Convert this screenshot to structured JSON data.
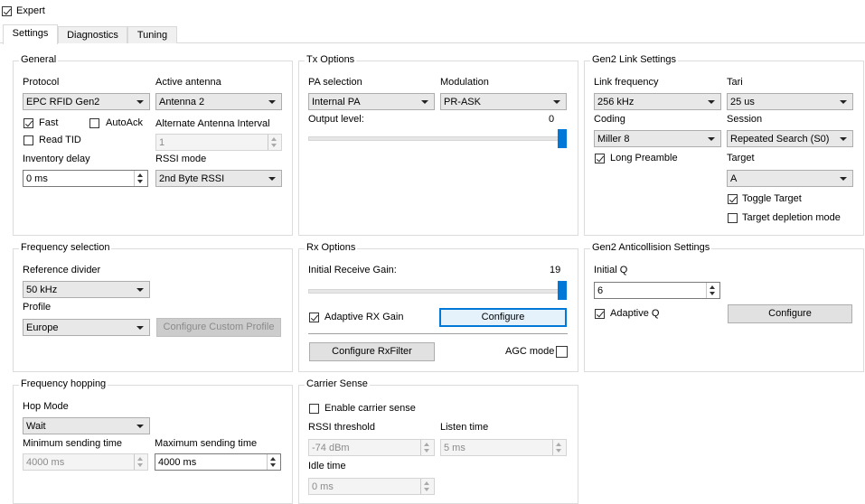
{
  "expert": {
    "label": "Expert",
    "checked": true
  },
  "tabs": [
    "Settings",
    "Diagnostics",
    "Tuning"
  ],
  "general": {
    "title": "General",
    "protocol_label": "Protocol",
    "protocol_value": "EPC RFID Gen2",
    "active_antenna_label": "Active antenna",
    "active_antenna_value": "Antenna 2",
    "fast_label": "Fast",
    "autoack_label": "AutoAck",
    "read_tid_label": "Read TID",
    "alt_antenna_label": "Alternate Antenna Interval",
    "alt_antenna_value": "1",
    "inventory_delay_label": "Inventory delay",
    "inventory_delay_value": "0 ms",
    "rssi_mode_label": "RSSI mode",
    "rssi_mode_value": "2nd Byte RSSI"
  },
  "tx": {
    "title": "Tx Options",
    "pa_label": "PA selection",
    "pa_value": "Internal PA",
    "modulation_label": "Modulation",
    "modulation_value": "PR-ASK",
    "output_level_label": "Output level:",
    "output_level_value": "0"
  },
  "gen2link": {
    "title": "Gen2 Link Settings",
    "link_freq_label": "Link frequency",
    "link_freq_value": "256 kHz",
    "tari_label": "Tari",
    "tari_value": "25 us",
    "coding_label": "Coding",
    "coding_value": "Miller 8",
    "session_label": "Session",
    "session_value": "Repeated Search (S0)",
    "long_preamble_label": "Long Preamble",
    "target_label": "Target",
    "target_value": "A",
    "toggle_target_label": "Toggle  Target",
    "target_depletion_label": "Target depletion mode"
  },
  "freq_sel": {
    "title": "Frequency selection",
    "ref_div_label": "Reference divider",
    "ref_div_value": "50 kHz",
    "profile_label": "Profile",
    "profile_value": "Europe",
    "configure_custom_label": "Configure Custom Profile"
  },
  "rx": {
    "title": "Rx Options",
    "initial_gain_label": "Initial Receive Gain:",
    "initial_gain_value": "19",
    "adaptive_rx_label": "Adaptive RX Gain",
    "configure_label": "Configure",
    "configure_rxfilter_label": "Configure RxFilter",
    "agc_label": "AGC mode"
  },
  "anticoll": {
    "title": "Gen2 Anticollision Settings",
    "initial_q_label": "Initial Q",
    "initial_q_value": "6",
    "adaptive_q_label": "Adaptive Q",
    "configure_label": "Configure"
  },
  "hopping": {
    "title": "Frequency hopping",
    "hop_mode_label": "Hop Mode",
    "hop_mode_value": "Wait",
    "min_send_label": "Minimum sending time",
    "min_send_value": "4000 ms",
    "max_send_label": "Maximum sending time",
    "max_send_value": "4000 ms"
  },
  "carrier": {
    "title": "Carrier Sense",
    "enable_label": "Enable carrier sense",
    "rssi_threshold_label": "RSSI threshold",
    "rssi_threshold_value": "-74 dBm",
    "listen_time_label": "Listen time",
    "listen_time_value": "5 ms",
    "idle_time_label": "Idle time",
    "idle_time_value": "0 ms"
  },
  "colors": {
    "accent": "#0078d7",
    "disabled_text": "#8a8a8a"
  }
}
